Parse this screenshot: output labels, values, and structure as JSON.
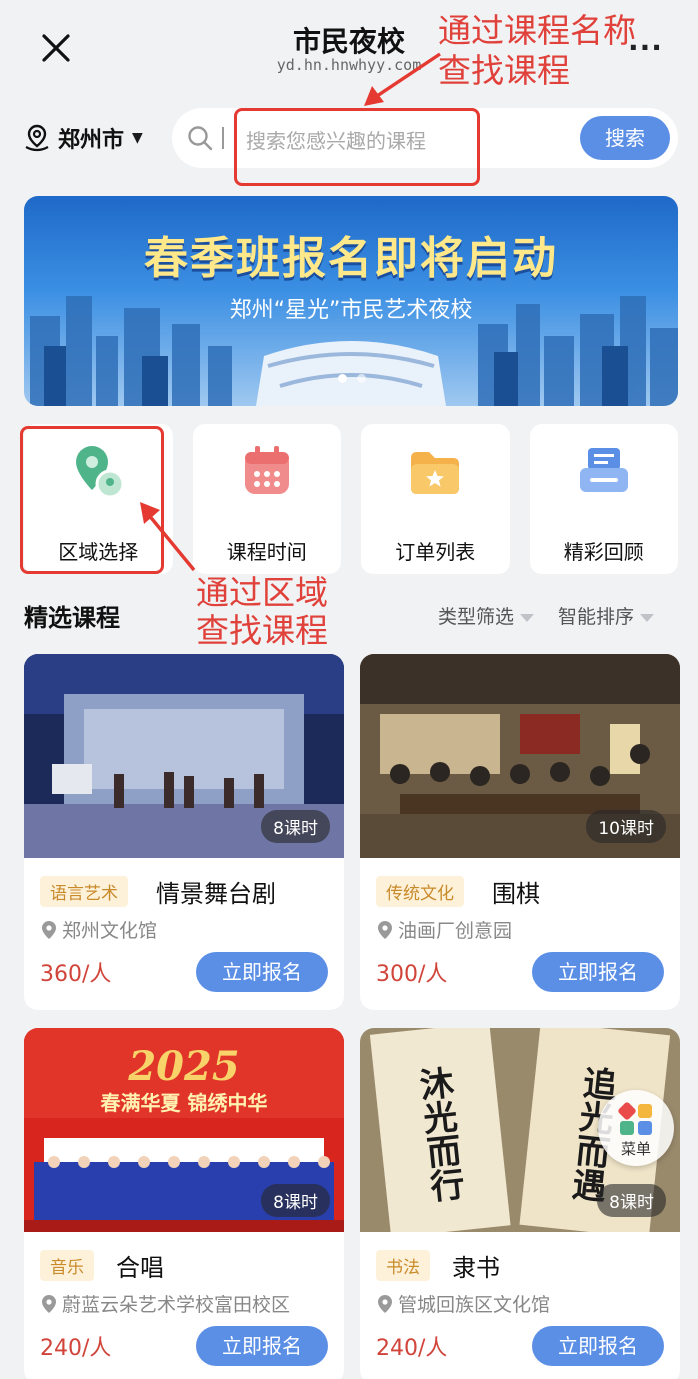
{
  "header": {
    "title": "市民夜校",
    "domain": "yd.hn.hnwhyy.com",
    "more": "..."
  },
  "search": {
    "city": "郑州市",
    "placeholder": "搜索您感兴趣的课程",
    "button": "搜索"
  },
  "annotations": {
    "by_name_line1": "通过课程名称",
    "by_name_line2": "查找课程",
    "by_area_line1": "通过区域",
    "by_area_line2": "查找课程"
  },
  "banner": {
    "title": "春季班报名即将启动",
    "subtitle": "郑州“星光”市民艺术夜校",
    "active_slide": 1,
    "slide_count": 2
  },
  "grid": [
    {
      "label": "区域选择",
      "icon": "map-pin-icon"
    },
    {
      "label": "课程时间",
      "icon": "calendar-icon"
    },
    {
      "label": "订单列表",
      "icon": "folder-star-icon"
    },
    {
      "label": "精彩回顾",
      "icon": "printer-icon"
    }
  ],
  "section": {
    "title": "精选课程",
    "filter_type": "类型筛选",
    "filter_sort": "智能排序"
  },
  "courses": [
    {
      "hours": "8课时",
      "tag": "语言艺术",
      "name": "情景舞台剧",
      "place": "郑州文化馆",
      "price": "360/人",
      "enroll": "立即报名"
    },
    {
      "hours": "10课时",
      "tag": "传统文化",
      "name": "围棋",
      "place": "油画厂创意园",
      "price": "300/人",
      "enroll": "立即报名"
    },
    {
      "hours": "8课时",
      "tag": "音乐",
      "name": "合唱",
      "place": "蔚蓝云朵艺术学校富田校区",
      "price": "240/人",
      "enroll": "立即报名"
    },
    {
      "hours": "8课时",
      "tag": "书法",
      "name": "隶书",
      "place": "管城回族区文化馆",
      "price": "240/人",
      "enroll": "立即报名"
    }
  ],
  "images": {
    "choir_text1": "2025",
    "choir_text2": "春满华夏 锦绣中华",
    "calligraphy_left": "沐光而行",
    "calligraphy_right": "追光而遇"
  },
  "menu": {
    "label": "菜单"
  },
  "colors": {
    "accent": "#5b8fe6",
    "annotation": "#e0413a",
    "price": "#d0443a"
  }
}
